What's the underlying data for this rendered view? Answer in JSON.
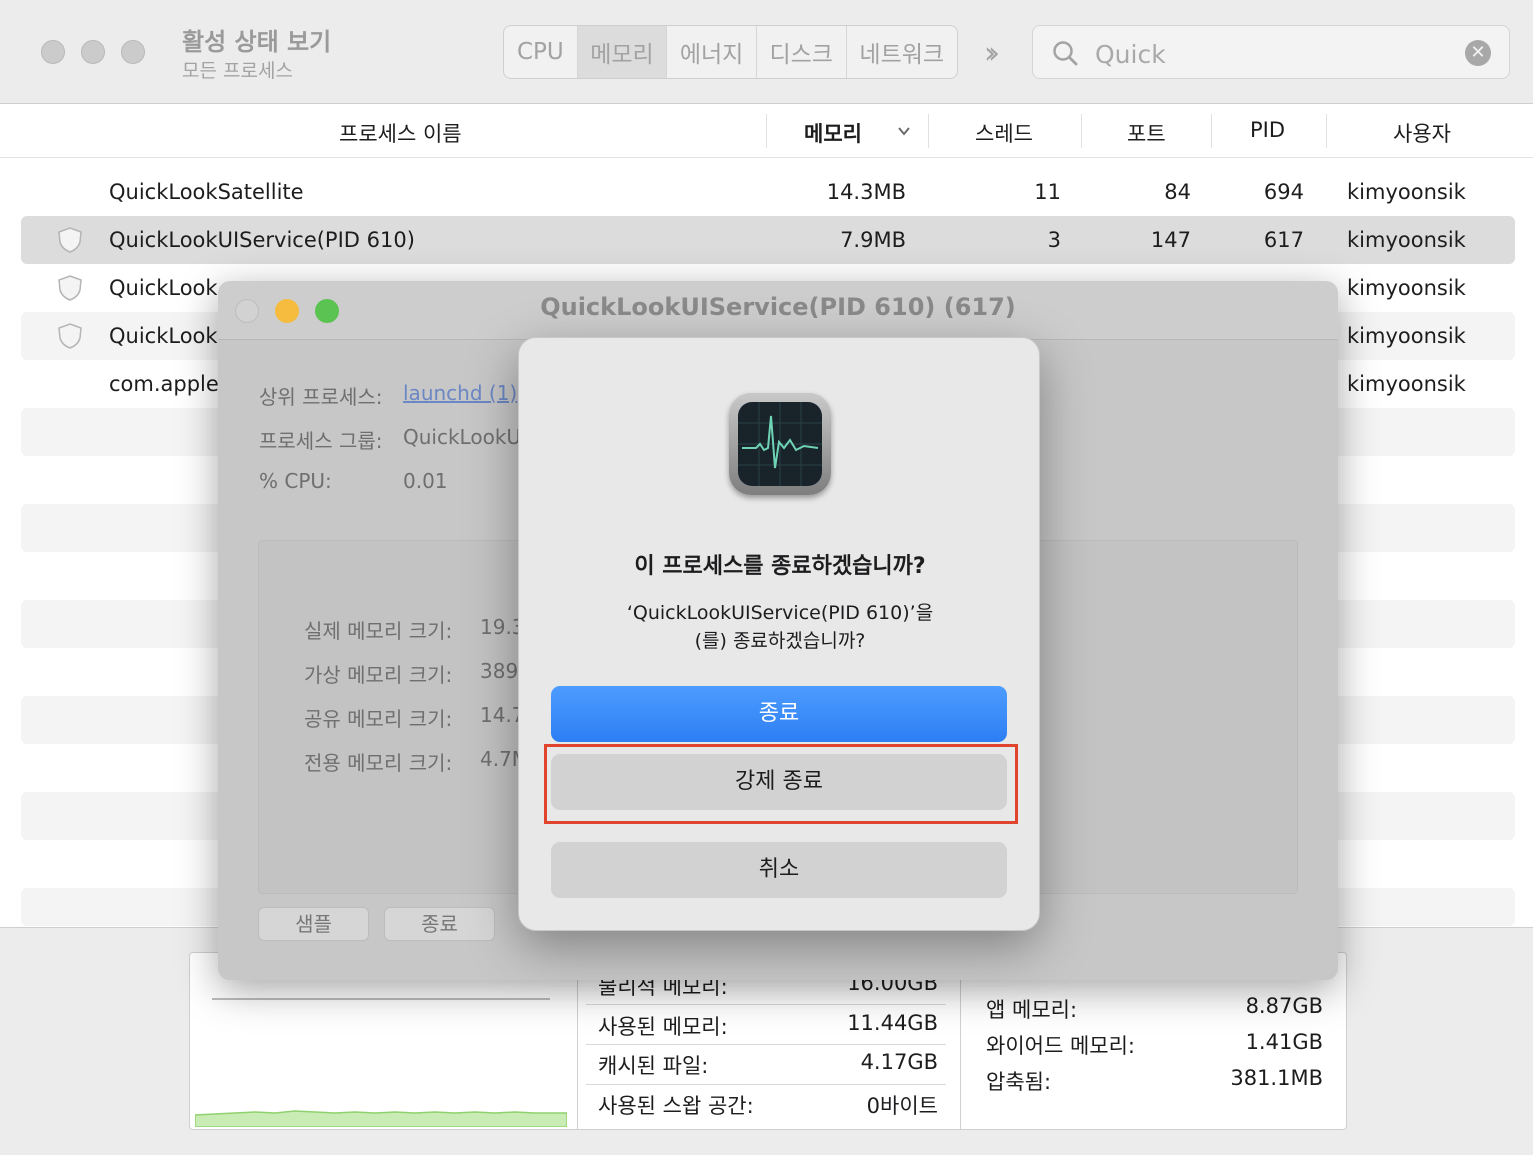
{
  "window": {
    "title": "활성 상태 보기",
    "subtitle": "모든 프로세스"
  },
  "tabs": [
    {
      "label": "CPU"
    },
    {
      "label": "메모리"
    },
    {
      "label": "에너지"
    },
    {
      "label": "디스크"
    },
    {
      "label": "네트워크"
    }
  ],
  "active_tab": "메모리",
  "search": {
    "value": "Quick"
  },
  "columns": {
    "name": "프로세스 이름",
    "memory": "메모리",
    "threads": "스레드",
    "ports": "포트",
    "pid": "PID",
    "user": "사용자"
  },
  "rows": [
    {
      "name": "QuickLookSatellite",
      "memory": "14.3MB",
      "threads": "11",
      "ports": "84",
      "pid": "694",
      "user": "kimyoonsik"
    },
    {
      "name": "QuickLookUIService(PID 610)",
      "memory": "7.9MB",
      "threads": "3",
      "ports": "147",
      "pid": "617",
      "user": "kimyoonsik"
    },
    {
      "name": "QuickLook",
      "user": "kimyoonsik"
    },
    {
      "name": "QuickLook",
      "user": "kimyoonsik"
    },
    {
      "name": "com.apple",
      "user": "kimyoonsik"
    }
  ],
  "memory_summary": {
    "col2": [
      {
        "label": "물리적 메모리:",
        "value": "16.00GB"
      },
      {
        "label": "사용된 메모리:",
        "value": "11.44GB"
      },
      {
        "label": "캐시된 파일:",
        "value": "4.17GB"
      },
      {
        "label": "사용된 스왑 공간:",
        "value": "0바이트"
      }
    ],
    "col3": [
      {
        "label": "앱 메모리:",
        "value": "8.87GB"
      },
      {
        "label": "와이어드 메모리:",
        "value": "1.41GB"
      },
      {
        "label": "압축됨:",
        "value": "381.1MB"
      }
    ]
  },
  "inspector": {
    "title": "QuickLookUIService(PID 610) (617)",
    "parent_label": "상위 프로세스:",
    "parent_value": "launchd (1)",
    "group_label": "프로세스 그룹:",
    "group_value": "QuickLookU",
    "cpu_label": "% CPU:",
    "cpu_value": "0.01",
    "mem_rows": [
      {
        "label": "실제 메모리 크기:",
        "value": "19.3"
      },
      {
        "label": "가상 메모리 크기:",
        "value": "389"
      },
      {
        "label": "공유 메모리 크기:",
        "value": "14.7"
      },
      {
        "label": "전용 메모리 크기:",
        "value": "4.7M"
      }
    ],
    "sample_button": "샘플",
    "quit_button": "종료"
  },
  "alert": {
    "title": "이 프로세스를 종료하겠습니까?",
    "message_line1": "‘QuickLookUIService(PID 610)’을",
    "message_line2": "(를) 종료하겠습니까?",
    "quit": "종료",
    "force_quit": "강제 종료",
    "cancel": "취소"
  },
  "colors": {
    "primary_button": "#2d7ef4",
    "highlight": "#e0432e",
    "memory_graph": "#a8e08a"
  }
}
